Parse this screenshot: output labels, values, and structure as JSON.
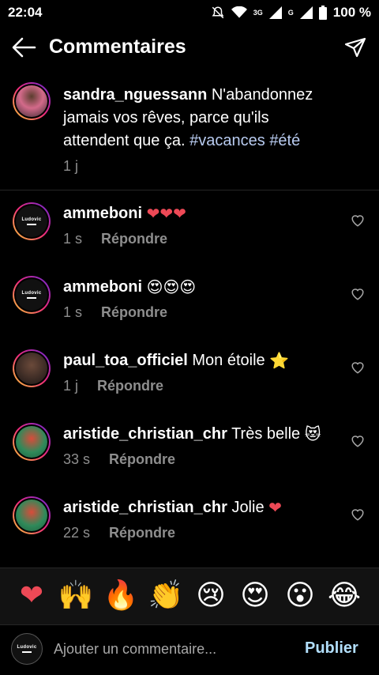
{
  "status_bar": {
    "time": "22:04",
    "network": "3G",
    "signal2": "G",
    "battery": "100 %"
  },
  "header": {
    "title": "Commentaires",
    "back_icon": "arrow-left-icon",
    "send_icon": "paper-plane-icon"
  },
  "caption": {
    "username": "sandra_nguessann",
    "text": " N'abandonnez jamais vos rêves, parce qu'ils attendent que ça. ",
    "hashtags": "#vacances #été",
    "time": "1 j"
  },
  "comments": [
    {
      "username": "ammeboni",
      "text": "",
      "emoji": "❤❤❤",
      "time": "1 s",
      "reply": "Répondre",
      "avatar_text": "Ludovic"
    },
    {
      "username": "ammeboni",
      "text": "",
      "emoji": "😍😍😍",
      "time": "1 s",
      "reply": "Répondre",
      "avatar_text": "Ludovic"
    },
    {
      "username": "paul_toa_officiel",
      "text": "Mon étoile",
      "emoji": "⭐",
      "time": "1 j",
      "reply": "Répondre"
    },
    {
      "username": "aristide_christian_chr",
      "text": "Très belle",
      "emoji": "😻",
      "time": "33 s",
      "reply": "Répondre"
    },
    {
      "username": "aristide_christian_chr",
      "text": "Jolie",
      "emoji": "❤",
      "time": "22 s",
      "reply": "Répondre"
    }
  ],
  "emoji_bar": [
    "❤",
    "🙌",
    "🔥",
    "👏",
    "😢",
    "😍",
    "😮",
    "😂"
  ],
  "composer": {
    "placeholder": "Ajouter un commentaire...",
    "publish": "Publier",
    "avatar_text": "Ludovic"
  }
}
